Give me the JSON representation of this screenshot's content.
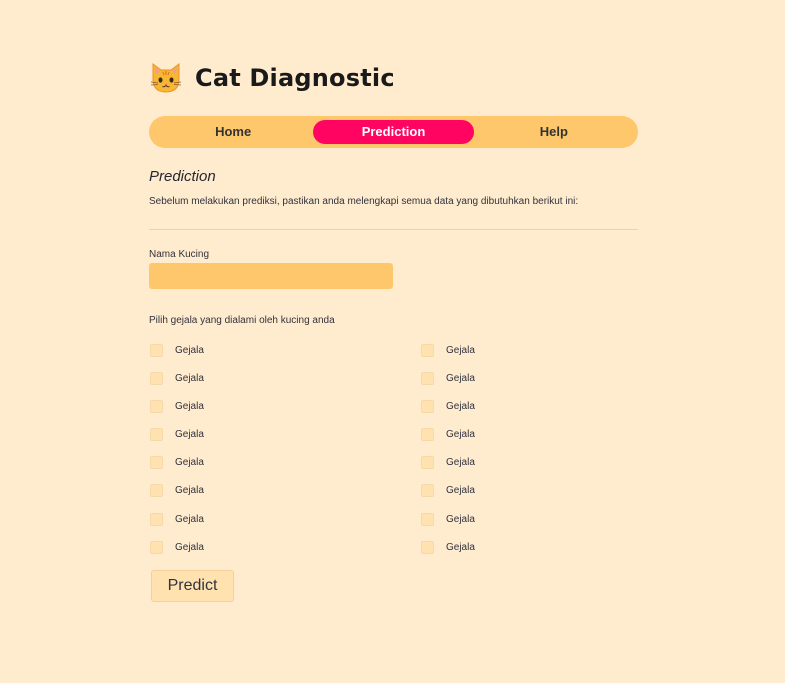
{
  "app": {
    "title": "Cat Diagnostic",
    "icon": "cat-face-icon"
  },
  "nav": {
    "items": [
      {
        "label": "Home",
        "active": false
      },
      {
        "label": "Prediction",
        "active": true
      },
      {
        "label": "Help",
        "active": false
      }
    ]
  },
  "prediction": {
    "title": "Prediction",
    "description": "Sebelum melakukan prediksi, pastikan anda melengkapi semua data yang dibutuhkan berikut ini:",
    "name_label": "Nama Kucing",
    "name_value": "",
    "symptom_label": "Pilih gejala yang dialami oleh kucing anda",
    "symptoms_left": [
      "Gejala",
      "Gejala",
      "Gejala",
      "Gejala",
      "Gejala",
      "Gejala",
      "Gejala",
      "Gejala"
    ],
    "symptoms_right": [
      "Gejala",
      "Gejala",
      "Gejala",
      "Gejala",
      "Gejala",
      "Gejala",
      "Gejala",
      "Gejala"
    ],
    "predict_label": "Predict"
  },
  "colors": {
    "background": "#ffebcd",
    "nav_bg": "#ffc76b",
    "accent": "#ff0561"
  }
}
